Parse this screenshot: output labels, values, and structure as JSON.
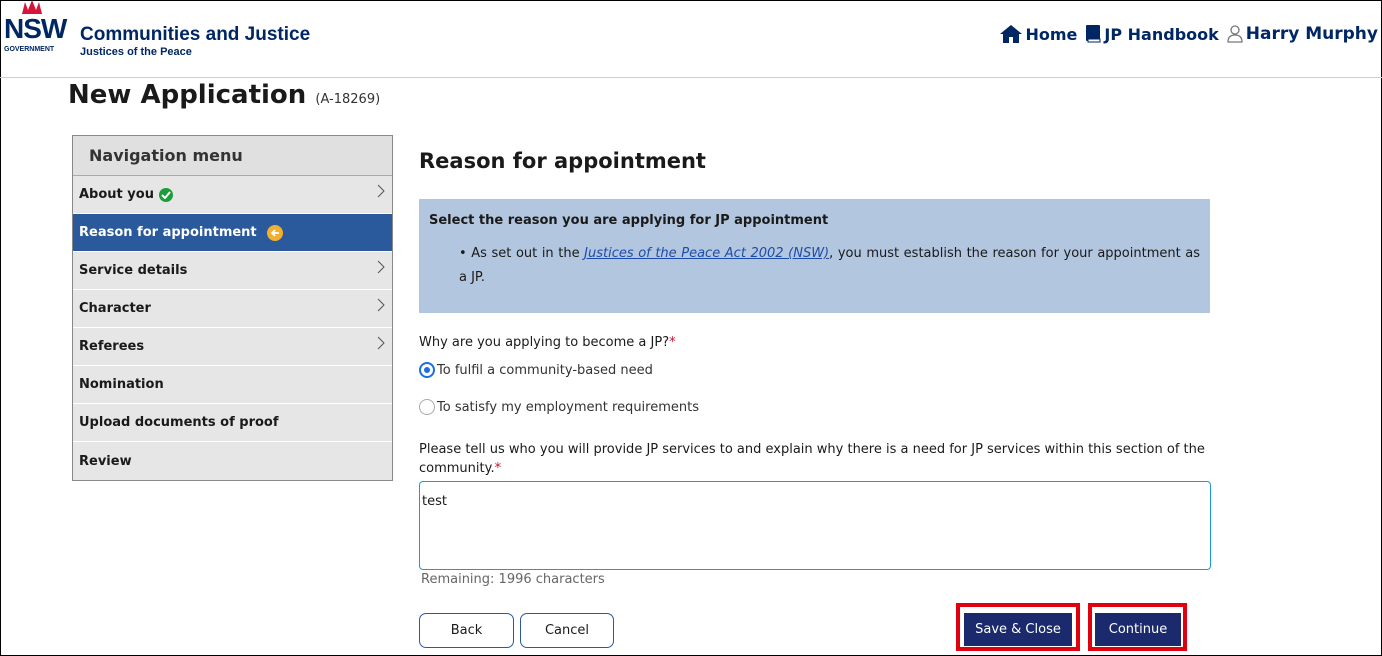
{
  "header": {
    "logo_text": "NSW",
    "logo_sub": "GOVERNMENT",
    "agency_name": "Communities and Justice",
    "agency_sub": "Justices of the Peace",
    "nav": [
      {
        "label": "Home",
        "icon": "home-icon"
      },
      {
        "label": "JP Handbook",
        "icon": "book-icon"
      }
    ],
    "user_name": "Harry Murphy",
    "user_icon": "person-icon"
  },
  "page": {
    "title": "New Application",
    "ref": "(A-18269)"
  },
  "sidebar": {
    "title": "Navigation menu",
    "items": [
      {
        "label": "About you",
        "status": "complete",
        "chevron": true
      },
      {
        "label": "Reason for appointment",
        "status": "current",
        "chevron": false
      },
      {
        "label": "Service details",
        "chevron": true
      },
      {
        "label": "Character",
        "chevron": true
      },
      {
        "label": "Referees",
        "chevron": true
      },
      {
        "label": "Nomination",
        "chevron": false
      },
      {
        "label": "Upload documents of proof",
        "chevron": false
      },
      {
        "label": "Review",
        "chevron": false
      }
    ]
  },
  "main": {
    "section_title": "Reason for appointment",
    "info": {
      "heading": "Select the reason you are applying for JP appointment",
      "bullet_prefix": "As set out in the ",
      "bullet_link": "Justices of the Peace Act 2002 (NSW)",
      "bullet_suffix": ", you must establish the reason for your appointment as a JP."
    },
    "question": "Why are you applying to become a JP?",
    "required_mark": "*",
    "options": [
      {
        "label": "To fulfil a community-based need",
        "checked": true
      },
      {
        "label": "To satisfy my employment requirements",
        "checked": false
      }
    ],
    "textarea_label": "Please tell us who you will provide JP services to and explain why there is a need for JP services within this section of the community.",
    "textarea_value": "test",
    "remaining": "Remaining: 1996 characters"
  },
  "actions": {
    "back": "Back",
    "cancel": "Cancel",
    "save_close": "Save & Close",
    "continue": "Continue"
  },
  "colors": {
    "brand_navy": "#002664",
    "active_nav": "#2a5a9c",
    "info_box": "#b3c6df",
    "primary_button": "#1a2a6c",
    "highlight": "#e0000f"
  }
}
